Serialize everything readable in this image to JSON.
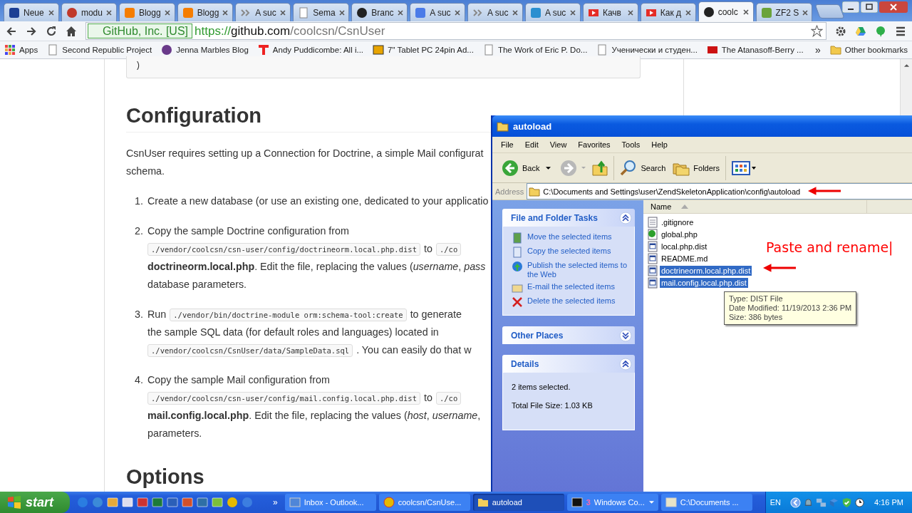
{
  "browser": {
    "tabs": [
      {
        "title": "Neue",
        "kind": "oneandone",
        "selected": false
      },
      {
        "title": "modu",
        "kind": "gear",
        "selected": false
      },
      {
        "title": "Blogg",
        "kind": "blogger",
        "selected": false
      },
      {
        "title": "Blogg",
        "kind": "blogger",
        "selected": false
      },
      {
        "title": "A suc",
        "kind": "chevrons",
        "selected": false
      },
      {
        "title": "Sema",
        "kind": "page",
        "selected": false
      },
      {
        "title": "Branc",
        "kind": "github",
        "selected": false
      },
      {
        "title": "A suc",
        "kind": "google",
        "selected": false
      },
      {
        "title": "A suc",
        "kind": "chevrons",
        "selected": false
      },
      {
        "title": "A suc",
        "kind": "paw",
        "selected": false
      },
      {
        "title": "Качв",
        "kind": "youtube",
        "selected": false
      },
      {
        "title": "Как д",
        "kind": "youtube",
        "selected": false
      },
      {
        "title": "coolc",
        "kind": "github",
        "selected": true
      },
      {
        "title": "ZF2 S",
        "kind": "zf",
        "selected": false
      }
    ],
    "address": {
      "identity": "GitHub, Inc. [US]",
      "scheme": "https://",
      "host": "github.com",
      "path": "/coolcsn/CsnUser"
    },
    "bookmarks": [
      {
        "label": "Apps",
        "kind": "apps"
      },
      {
        "label": "Second Republic Project",
        "kind": "page"
      },
      {
        "label": "Jenna Marbles Blog",
        "kind": "cat"
      },
      {
        "label": "Andy Puddicombe: All i...",
        "kind": "red"
      },
      {
        "label": "7\" Tablet PC 24pin Ad...",
        "kind": "shop"
      },
      {
        "label": "The Work of Eric P. Do...",
        "kind": "page"
      },
      {
        "label": "Ученически и студен...",
        "kind": "page"
      },
      {
        "label": "The Atanasoff-Berry ...",
        "kind": "youtube"
      }
    ],
    "bookmarks_overflow": "»",
    "other_bookmarks": "Other bookmarks"
  },
  "page": {
    "code_tail": ")",
    "heading": "Configuration",
    "intro": [
      "CsnUser requires setting up a Connection for Doctrine, a simple Mail configurat",
      "schema."
    ],
    "steps": [
      {
        "number": "1.",
        "lines": [
          [
            {
              "kind": "text",
              "text": "Create a new database (or use an existing one, dedicated to your applicatio"
            }
          ]
        ]
      },
      {
        "number": "2.",
        "lines": [
          [
            {
              "kind": "text",
              "text": "Copy the sample Doctrine configuration from"
            }
          ],
          [
            {
              "kind": "code",
              "text": "./vendor/coolcsn/csn-user/config/doctrineorm.local.php.dist"
            },
            {
              "kind": "text",
              "text": "to"
            },
            {
              "kind": "code",
              "text": "./co"
            }
          ],
          [
            {
              "kind": "text",
              "text": "**doctrineorm.local.php**. Edit the file, replacing the values (*username*, *pass*"
            }
          ],
          [
            {
              "kind": "text",
              "text": "database parameters."
            }
          ]
        ]
      },
      {
        "number": "3.",
        "lines": [
          [
            {
              "kind": "text",
              "text": "Run"
            },
            {
              "kind": "code",
              "text": "./vendor/bin/doctrine-module orm:schema-tool:create"
            },
            {
              "kind": "text",
              "text": "to generate"
            }
          ],
          [
            {
              "kind": "text",
              "text": "the sample SQL data (for default roles and languages) located in"
            }
          ],
          [
            {
              "kind": "code",
              "text": "./vendor/coolcsn/CsnUser/data/SampleData.sql"
            },
            {
              "kind": "text",
              "text": ". You can easily do that w"
            }
          ]
        ]
      },
      {
        "number": "4.",
        "lines": [
          [
            {
              "kind": "text",
              "text": "Copy the sample Mail configuration from"
            }
          ],
          [
            {
              "kind": "code",
              "text": "./vendor/coolcsn/csn-user/config/mail.config.local.php.dist"
            },
            {
              "kind": "text",
              "text": "to"
            },
            {
              "kind": "code",
              "text": "./co"
            }
          ],
          [
            {
              "kind": "text",
              "text": "**mail.config.local.php**. Edit the file, replacing the values (*host*, *username*,"
            }
          ],
          [
            {
              "kind": "text",
              "text": "parameters."
            }
          ]
        ]
      }
    ],
    "heading_2": "Options"
  },
  "explorer": {
    "title": "autoload",
    "menu": [
      "File",
      "Edit",
      "View",
      "Favorites",
      "Tools",
      "Help"
    ],
    "toolbar": {
      "back": "Back",
      "search": "Search",
      "folders": "Folders"
    },
    "address_label": "Address",
    "address": "C:\\Documents and Settings\\user\\ZendSkeletonApplication\\config\\autoload",
    "tasks": {
      "title": "File and Folder Tasks",
      "expanded": true,
      "items": [
        {
          "label": "Move the selected items",
          "kind": "move"
        },
        {
          "label": "Copy the selected items",
          "kind": "copy"
        },
        {
          "label": "Publish the selected items to the Web",
          "kind": "publish"
        },
        {
          "label": "E-mail the selected items",
          "kind": "email"
        },
        {
          "label": "Delete the selected items",
          "kind": "delete"
        }
      ]
    },
    "other_places": {
      "title": "Other Places",
      "expanded": false
    },
    "details": {
      "title": "Details",
      "expanded": true,
      "lines": [
        "2 items selected.",
        "Total File Size: 1.03 KB"
      ]
    },
    "column": "Name",
    "files": [
      {
        "name": ".gitignore",
        "kind": "text",
        "selected": false
      },
      {
        "name": "global.php",
        "kind": "php",
        "selected": false
      },
      {
        "name": "local.php.dist",
        "kind": "window",
        "selected": false
      },
      {
        "name": "README.md",
        "kind": "window",
        "selected": false
      },
      {
        "name": "doctrineorm.local.php.dist",
        "kind": "window",
        "selected": true
      },
      {
        "name": "mail.config.local.php.dist",
        "kind": "window",
        "selected": true
      }
    ],
    "tooltip": [
      "Type: DIST File",
      "Date Modified: 11/19/2013 2:36 PM",
      "Size: 386 bytes"
    ]
  },
  "annotation": "Paste and rename|",
  "taskbar": {
    "start": "start",
    "overflow": "»",
    "quick_launch": [
      {
        "kind": "ie"
      },
      {
        "kind": "refresh"
      },
      {
        "kind": "browser"
      },
      {
        "kind": "window"
      },
      {
        "kind": "flag"
      },
      {
        "kind": "excel"
      },
      {
        "kind": "word"
      },
      {
        "kind": "powerpoint"
      },
      {
        "kind": "photoshop"
      },
      {
        "kind": "leaf"
      },
      {
        "kind": "chrome"
      },
      {
        "kind": "media"
      }
    ],
    "tasks": [
      {
        "label": "Inbox - Outlook...",
        "kind": "outlook",
        "selected": false
      },
      {
        "label": "coolcsn/CsnUse...",
        "kind": "chrome",
        "selected": false
      },
      {
        "label": "autoload",
        "kind": "folder",
        "selected": true
      },
      {
        "count": "3",
        "label": "Windows Co...",
        "kind": "console",
        "selected": false
      },
      {
        "label": "C:\\Documents ...",
        "kind": "notepad",
        "selected": false
      }
    ],
    "language": "EN",
    "clock": "4:16 PM"
  }
}
